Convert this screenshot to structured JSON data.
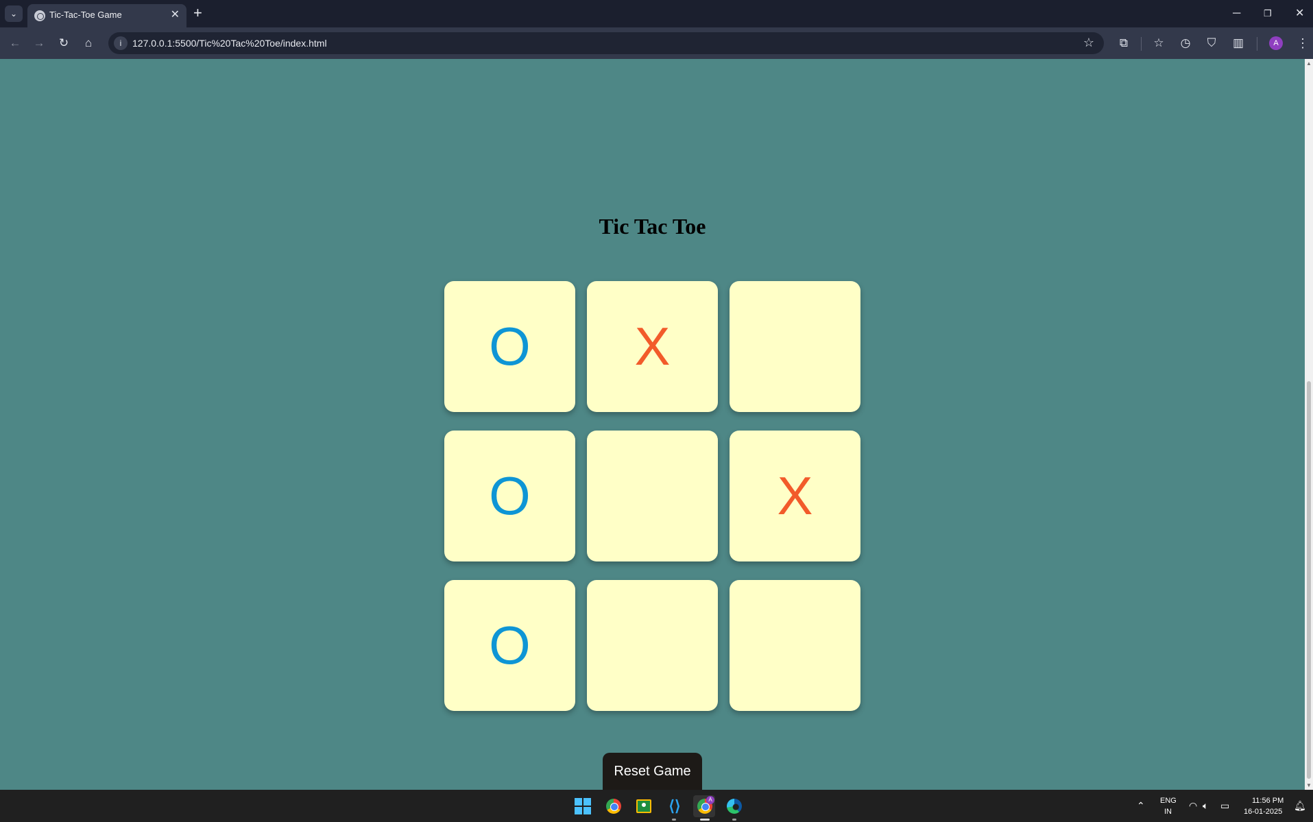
{
  "browser": {
    "tab_title": "Tic-Tac-Toe Game",
    "url": "127.0.0.1:5500/Tic%20Tac%20Toe/index.html",
    "profile_initial": "A"
  },
  "game": {
    "title": "Tic Tac Toe",
    "board": [
      "O",
      "X",
      "",
      "O",
      "",
      "X",
      "O",
      "",
      ""
    ],
    "reset_label": "Reset Game",
    "colors": {
      "background": "#4e8786",
      "cell": "#ffffc7",
      "o_mark": "#0e95d5",
      "x_mark": "#f25b2a",
      "reset_button": "#1d1a17"
    }
  },
  "taskbar": {
    "language": "ENG",
    "region": "IN",
    "time": "11:56 PM",
    "date": "16-01-2025",
    "chrome_badge": "A",
    "apps": [
      "windows-start-icon",
      "chrome-icon",
      "google-classroom-icon",
      "vscode-icon",
      "chrome-profile-icon",
      "edge-icon"
    ]
  }
}
